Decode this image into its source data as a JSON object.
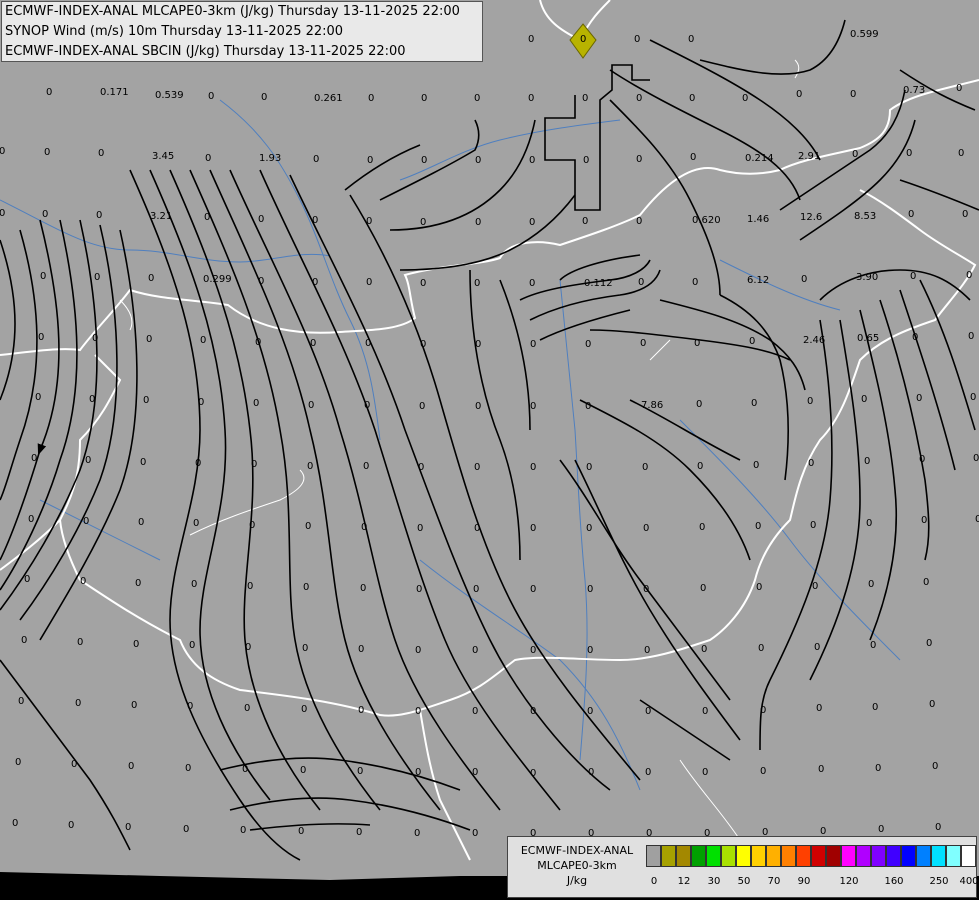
{
  "header": {
    "line1": "ECMWF-INDEX-ANAL MLCAPE0-3km (J/kg) Thursday 13-11-2025 22:00",
    "line2": "SYNOP Wind (m/s) 10m Thursday 13-11-2025 22:00",
    "line3": "ECMWF-INDEX-ANAL SBCIN (J/kg) Thursday 13-11-2025 22:00"
  },
  "legend": {
    "line1": "ECMWF-INDEX-ANAL",
    "line2": "MLCAPE0-3km",
    "unit": "J/kg",
    "colors": [
      "#a0a0a0",
      "#a6a100",
      "#a38800",
      "#00a000",
      "#00e000",
      "#a8e000",
      "#ffff00",
      "#ffd000",
      "#ffb000",
      "#ff8000",
      "#ff4000",
      "#d00000",
      "#a00000",
      "#ff00ff",
      "#b000ff",
      "#8000ff",
      "#4000ff",
      "#0000ff",
      "#0080ff",
      "#00e0ff",
      "#80ffff",
      "#ffffff"
    ],
    "ticks": [
      "0",
      "12",
      "30",
      "50",
      "70",
      "90",
      "120",
      "160",
      "250",
      "400"
    ]
  },
  "map": {
    "background": "#a3a3a3",
    "border_color": "#ffffff",
    "river_color": "#4f7fbf",
    "streamline_color": "#000000",
    "marker_icon": "yellow-diamond-icon",
    "values": [
      [
        "0",
        6,
        11
      ],
      [
        "0",
        95,
        38
      ],
      [
        "0",
        175,
        38
      ],
      [
        "0",
        258,
        38
      ],
      [
        "0",
        366,
        38
      ],
      [
        "0",
        474,
        38
      ],
      [
        "0",
        528,
        38
      ],
      [
        "0",
        582,
        38
      ],
      [
        "0",
        634,
        38
      ],
      [
        "0",
        688,
        38
      ],
      [
        "0.599",
        850,
        33
      ],
      [
        "0",
        46,
        91
      ],
      [
        "0.171",
        100,
        91
      ],
      [
        "0.539",
        155,
        94
      ],
      [
        "0",
        208,
        95
      ],
      [
        "0",
        261,
        96
      ],
      [
        "0.261",
        314,
        97
      ],
      [
        "0",
        368,
        97
      ],
      [
        "0",
        421,
        97
      ],
      [
        "0",
        474,
        97
      ],
      [
        "0",
        528,
        97
      ],
      [
        "0",
        582,
        97
      ],
      [
        "0",
        636,
        97
      ],
      [
        "0",
        689,
        97
      ],
      [
        "0",
        742,
        97
      ],
      [
        "0",
        796,
        93
      ],
      [
        "0",
        850,
        93
      ],
      [
        "0.73",
        903,
        89
      ],
      [
        "0",
        956,
        87
      ],
      [
        "0",
        -1,
        150
      ],
      [
        "0",
        44,
        151
      ],
      [
        "0",
        98,
        152
      ],
      [
        "3.45",
        152,
        155
      ],
      [
        "0",
        205,
        157
      ],
      [
        "1.93",
        259,
        157
      ],
      [
        "0",
        313,
        158
      ],
      [
        "0",
        367,
        159
      ],
      [
        "0",
        421,
        159
      ],
      [
        "0",
        475,
        159
      ],
      [
        "0",
        529,
        159
      ],
      [
        "0",
        583,
        159
      ],
      [
        "0",
        636,
        158
      ],
      [
        "0",
        690,
        156
      ],
      [
        "0.214",
        745,
        157
      ],
      [
        "2.91",
        798,
        155
      ],
      [
        "0",
        852,
        153
      ],
      [
        "0",
        906,
        152
      ],
      [
        "0",
        958,
        152
      ],
      [
        "0",
        -1,
        212
      ],
      [
        "0",
        42,
        213
      ],
      [
        "0",
        96,
        214
      ],
      [
        "3.21",
        150,
        215
      ],
      [
        "0",
        204,
        216
      ],
      [
        "0",
        258,
        218
      ],
      [
        "0",
        312,
        219
      ],
      [
        "0",
        366,
        220
      ],
      [
        "0",
        420,
        221
      ],
      [
        "0",
        475,
        221
      ],
      [
        "0",
        529,
        221
      ],
      [
        "0",
        582,
        220
      ],
      [
        "0",
        636,
        220
      ],
      [
        "0.620",
        692,
        219
      ],
      [
        "1.46",
        747,
        218
      ],
      [
        "12.6",
        800,
        216
      ],
      [
        "8.53",
        854,
        215
      ],
      [
        "0",
        908,
        213
      ],
      [
        "0",
        962,
        213
      ],
      [
        "0",
        40,
        275
      ],
      [
        "0",
        94,
        276
      ],
      [
        "0",
        148,
        277
      ],
      [
        "0.299",
        203,
        278
      ],
      [
        "0",
        258,
        280
      ],
      [
        "0",
        312,
        281
      ],
      [
        "0",
        366,
        281
      ],
      [
        "0",
        420,
        282
      ],
      [
        "0",
        474,
        282
      ],
      [
        "0",
        529,
        282
      ],
      [
        "0.112",
        584,
        282
      ],
      [
        "0",
        638,
        281
      ],
      [
        "0",
        692,
        281
      ],
      [
        "6.12",
        747,
        279
      ],
      [
        "0",
        801,
        278
      ],
      [
        "3.90",
        856,
        276
      ],
      [
        "0",
        910,
        275
      ],
      [
        "0",
        966,
        274
      ],
      [
        "0",
        38,
        336
      ],
      [
        "0",
        92,
        337
      ],
      [
        "0",
        146,
        338
      ],
      [
        "0",
        200,
        339
      ],
      [
        "0",
        255,
        341
      ],
      [
        "0",
        310,
        342
      ],
      [
        "0",
        365,
        342
      ],
      [
        "0",
        420,
        343
      ],
      [
        "0",
        475,
        343
      ],
      [
        "0",
        530,
        343
      ],
      [
        "0",
        585,
        343
      ],
      [
        "0",
        640,
        342
      ],
      [
        "0",
        694,
        342
      ],
      [
        "0",
        749,
        340
      ],
      [
        "2.46",
        803,
        339
      ],
      [
        "0.65",
        857,
        337
      ],
      [
        "0",
        912,
        336
      ],
      [
        "0",
        968,
        335
      ],
      [
        "0",
        35,
        396
      ],
      [
        "0",
        89,
        398
      ],
      [
        "0",
        143,
        399
      ],
      [
        "0",
        198,
        401
      ],
      [
        "0",
        253,
        402
      ],
      [
        "0",
        308,
        404
      ],
      [
        "0",
        364,
        404
      ],
      [
        "0",
        419,
        405
      ],
      [
        "0",
        475,
        405
      ],
      [
        "0",
        530,
        405
      ],
      [
        "0",
        585,
        405
      ],
      [
        "7.86",
        641,
        404
      ],
      [
        "0",
        696,
        403
      ],
      [
        "0",
        751,
        402
      ],
      [
        "0",
        807,
        400
      ],
      [
        "0",
        861,
        398
      ],
      [
        "0",
        916,
        397
      ],
      [
        "0",
        970,
        396
      ],
      [
        "0",
        31,
        457
      ],
      [
        "0",
        85,
        459
      ],
      [
        "0",
        140,
        461
      ],
      [
        "0",
        195,
        462
      ],
      [
        "0",
        251,
        463
      ],
      [
        "0",
        307,
        465
      ],
      [
        "0",
        363,
        465
      ],
      [
        "0",
        418,
        466
      ],
      [
        "0",
        474,
        466
      ],
      [
        "0",
        530,
        466
      ],
      [
        "0",
        586,
        466
      ],
      [
        "0",
        642,
        466
      ],
      [
        "0",
        697,
        465
      ],
      [
        "0",
        753,
        464
      ],
      [
        "0",
        808,
        462
      ],
      [
        "0",
        864,
        460
      ],
      [
        "0",
        919,
        458
      ],
      [
        "0",
        973,
        457
      ],
      [
        "0",
        28,
        518
      ],
      [
        "0",
        83,
        520
      ],
      [
        "0",
        138,
        521
      ],
      [
        "0",
        193,
        522
      ],
      [
        "0",
        249,
        524
      ],
      [
        "0",
        305,
        525
      ],
      [
        "0",
        361,
        526
      ],
      [
        "0",
        417,
        527
      ],
      [
        "0",
        474,
        527
      ],
      [
        "0",
        530,
        527
      ],
      [
        "0",
        586,
        527
      ],
      [
        "0",
        643,
        527
      ],
      [
        "0",
        699,
        526
      ],
      [
        "0",
        755,
        525
      ],
      [
        "0",
        810,
        524
      ],
      [
        "0",
        866,
        522
      ],
      [
        "0",
        921,
        519
      ],
      [
        "0",
        975,
        518
      ],
      [
        "0",
        24,
        578
      ],
      [
        "0",
        80,
        580
      ],
      [
        "0",
        135,
        582
      ],
      [
        "0",
        191,
        583
      ],
      [
        "0",
        247,
        585
      ],
      [
        "0",
        303,
        586
      ],
      [
        "0",
        360,
        587
      ],
      [
        "0",
        416,
        588
      ],
      [
        "0",
        473,
        588
      ],
      [
        "0",
        530,
        588
      ],
      [
        "0",
        587,
        588
      ],
      [
        "0",
        643,
        588
      ],
      [
        "0",
        700,
        587
      ],
      [
        "0",
        756,
        586
      ],
      [
        "0",
        812,
        585
      ],
      [
        "0",
        868,
        583
      ],
      [
        "0",
        923,
        581
      ],
      [
        "0",
        21,
        639
      ],
      [
        "0",
        77,
        641
      ],
      [
        "0",
        133,
        643
      ],
      [
        "0",
        189,
        644
      ],
      [
        "0",
        245,
        646
      ],
      [
        "0",
        302,
        647
      ],
      [
        "0",
        358,
        648
      ],
      [
        "0",
        415,
        649
      ],
      [
        "0",
        472,
        649
      ],
      [
        "0",
        530,
        649
      ],
      [
        "0",
        587,
        649
      ],
      [
        "0",
        644,
        649
      ],
      [
        "0",
        701,
        648
      ],
      [
        "0",
        758,
        647
      ],
      [
        "0",
        814,
        646
      ],
      [
        "0",
        870,
        644
      ],
      [
        "0",
        926,
        642
      ],
      [
        "0",
        18,
        700
      ],
      [
        "0",
        75,
        702
      ],
      [
        "0",
        131,
        704
      ],
      [
        "0",
        187,
        705
      ],
      [
        "0",
        244,
        707
      ],
      [
        "0",
        301,
        708
      ],
      [
        "0",
        358,
        709
      ],
      [
        "0",
        415,
        710
      ],
      [
        "0",
        472,
        710
      ],
      [
        "0",
        530,
        710
      ],
      [
        "0",
        587,
        710
      ],
      [
        "0",
        645,
        710
      ],
      [
        "0",
        702,
        710
      ],
      [
        "0",
        760,
        709
      ],
      [
        "0",
        816,
        707
      ],
      [
        "0",
        872,
        706
      ],
      [
        "0",
        929,
        703
      ],
      [
        "0",
        15,
        761
      ],
      [
        "0",
        71,
        763
      ],
      [
        "0",
        128,
        765
      ],
      [
        "0",
        185,
        767
      ],
      [
        "0",
        242,
        768
      ],
      [
        "0",
        300,
        769
      ],
      [
        "0",
        357,
        770
      ],
      [
        "0",
        415,
        771
      ],
      [
        "0",
        472,
        771
      ],
      [
        "0",
        530,
        772
      ],
      [
        "0",
        588,
        771
      ],
      [
        "0",
        645,
        771
      ],
      [
        "0",
        702,
        771
      ],
      [
        "0",
        760,
        770
      ],
      [
        "0",
        818,
        768
      ],
      [
        "0",
        875,
        767
      ],
      [
        "0",
        932,
        765
      ],
      [
        "0",
        12,
        822
      ],
      [
        "0",
        68,
        824
      ],
      [
        "0",
        125,
        826
      ],
      [
        "0",
        183,
        828
      ],
      [
        "0",
        240,
        829
      ],
      [
        "0",
        298,
        830
      ],
      [
        "0",
        356,
        831
      ],
      [
        "0",
        414,
        832
      ],
      [
        "0",
        472,
        832
      ],
      [
        "0",
        530,
        832
      ],
      [
        "0",
        588,
        832
      ],
      [
        "0",
        646,
        832
      ],
      [
        "0",
        704,
        832
      ],
      [
        "0",
        762,
        831
      ],
      [
        "0",
        820,
        830
      ],
      [
        "0",
        878,
        828
      ],
      [
        "0",
        935,
        826
      ]
    ]
  }
}
